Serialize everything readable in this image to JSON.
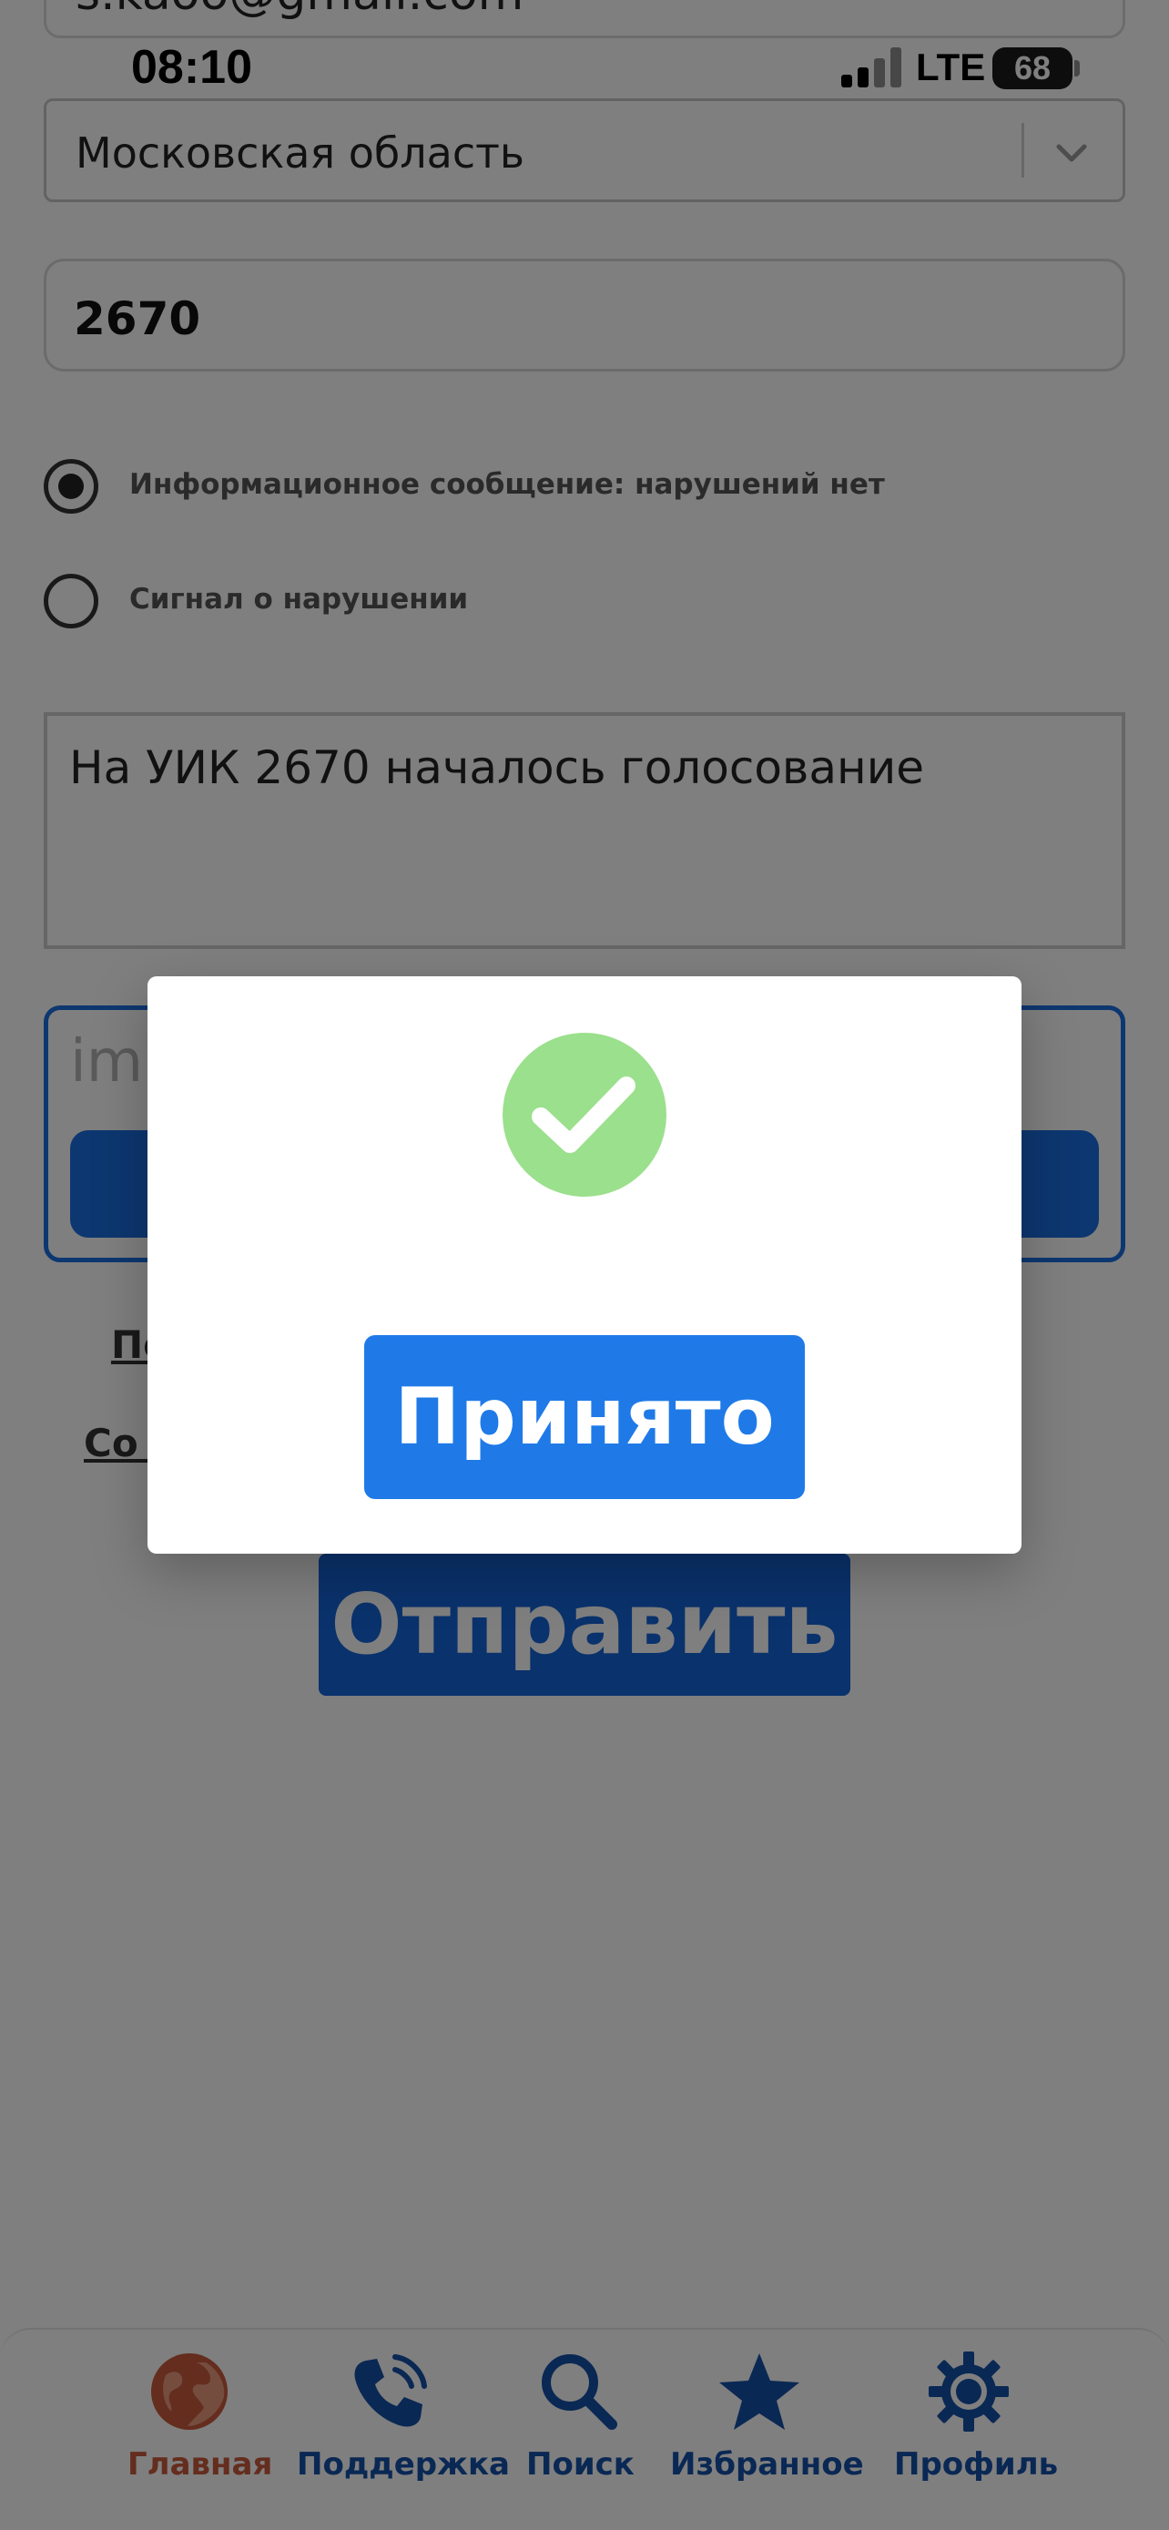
{
  "status_bar": {
    "time": "08:10",
    "network": "LTE",
    "battery": "68"
  },
  "form": {
    "email_value": "s.kaoo@gmail.com",
    "region": "Московская область",
    "uik_number": "2670",
    "radio_options": [
      {
        "label": "Информационное сообщение: нарушений нет",
        "selected": true
      },
      {
        "label": "Сигнал о нарушении",
        "selected": false
      }
    ],
    "message": "На УИК 2670 началось голосование",
    "upload_placeholder": "im",
    "link_1": "По                                                                         ых",
    "link_2": "Со                                                                           ных",
    "submit_label": "Отправить"
  },
  "modal": {
    "button_label": "Принято",
    "success_color": "#9be08c"
  },
  "nav": {
    "items": [
      {
        "label": "Главная",
        "icon": "globe-icon",
        "active": true
      },
      {
        "label": "Поддержка",
        "icon": "phone-icon",
        "active": false
      },
      {
        "label": "Поиск",
        "icon": "search-icon",
        "active": false
      },
      {
        "label": "Избранное",
        "icon": "star-icon",
        "active": false
      },
      {
        "label": "Профиль",
        "icon": "gear-icon",
        "active": false
      }
    ]
  },
  "colors": {
    "primary": "#1565d8",
    "active_nav": "#c85a3c",
    "nav_text": "#1450a8"
  }
}
